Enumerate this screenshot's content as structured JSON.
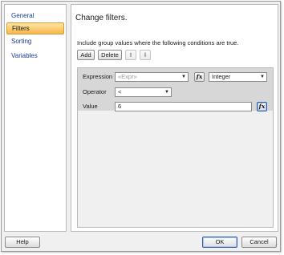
{
  "sidebar": {
    "items": [
      {
        "label": "General"
      },
      {
        "label": "Filters"
      },
      {
        "label": "Sorting"
      },
      {
        "label": "Variables"
      }
    ],
    "selected": "Filters"
  },
  "main": {
    "title": "Change filters.",
    "instructions": "Include group values where the following conditions are true.",
    "toolbar": {
      "add_label": "Add",
      "delete_label": "Delete",
      "move_up_icon": "arrow-up-icon",
      "move_down_icon": "arrow-down-icon"
    },
    "filter": {
      "expression_label": "Expression",
      "expression_placeholder": "«Expr»",
      "type_value": "Integer",
      "operator_label": "Operator",
      "operator_value": "<",
      "value_label": "Value",
      "value_value": "6",
      "fx_label": "fx"
    }
  },
  "footer": {
    "help_label": "Help",
    "ok_label": "OK",
    "cancel_label": "Cancel"
  },
  "colors": {
    "selection": "#f7b54a",
    "nav_link": "#1a3d8f",
    "grid_area": "#d7d7d7"
  }
}
